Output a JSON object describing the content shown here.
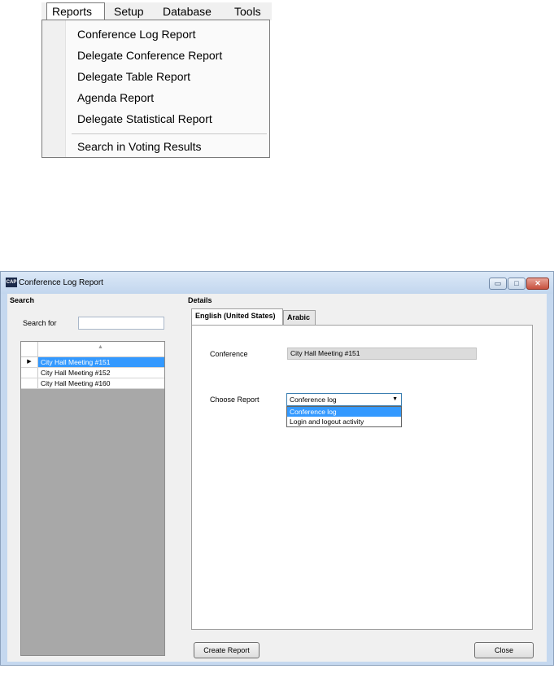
{
  "menubar": {
    "items": [
      "Reports",
      "Setup",
      "Database",
      "Tools"
    ],
    "dropdown": [
      "Conference Log Report",
      "Delegate Conference Report",
      "Delegate Table Report",
      "Agenda Report",
      "Delegate Statistical Report",
      "Search in Voting Results"
    ]
  },
  "window": {
    "title": "Conference Log Report",
    "icon_text": "CAP",
    "controls": {
      "minimize": "▭",
      "maximize": "□",
      "close": "✕"
    }
  },
  "search": {
    "group_label": "Search",
    "search_for_label": "Search for",
    "search_value": "",
    "rows": [
      "City Hall Meeting #151",
      "City Hall Meeting #152",
      "City Hall Meeting #160"
    ],
    "selected_index": 0,
    "row_marker": "▶",
    "sort_glyph": "▲"
  },
  "details": {
    "group_label": "Details",
    "tabs": [
      "English (United States)",
      "Arabic"
    ],
    "active_tab": 0,
    "conference_label": "Conference",
    "conference_value": "City Hall Meeting #151",
    "choose_report_label": "Choose Report",
    "report_selected": "Conference log",
    "report_options": [
      "Conference log",
      "Login and logout activity"
    ],
    "highlighted_option": 0,
    "dropdown_arrow": "▼"
  },
  "buttons": {
    "create_report": "Create Report",
    "close": "Close"
  }
}
